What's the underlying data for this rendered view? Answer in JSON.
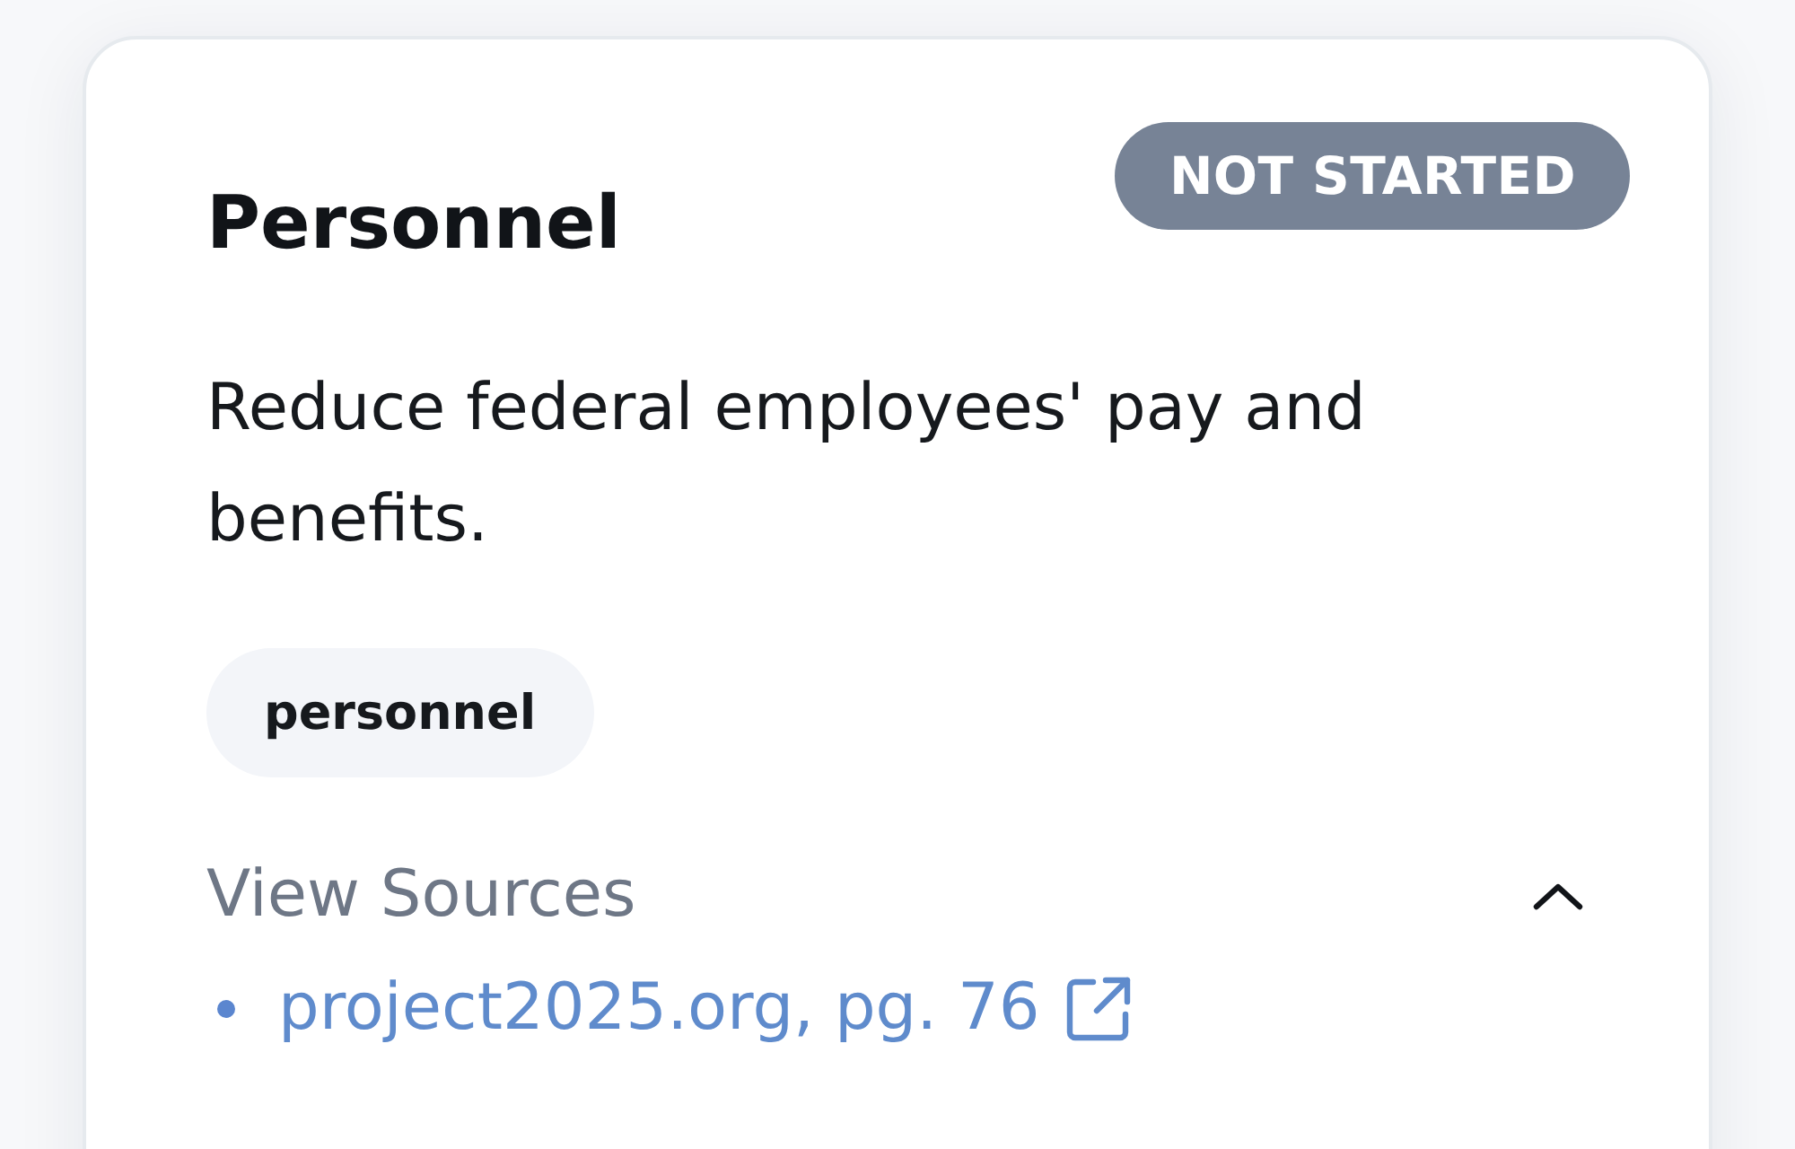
{
  "card": {
    "title": "Personnel",
    "status": {
      "label": "NOT STARTED",
      "kind": "not_started"
    },
    "description": "Reduce federal employees' pay and benefits.",
    "tags": [
      "personnel"
    ],
    "sources": {
      "label": "View Sources",
      "expanded": true,
      "items": [
        {
          "label": "project2025.org, pg. 76"
        }
      ]
    }
  }
}
